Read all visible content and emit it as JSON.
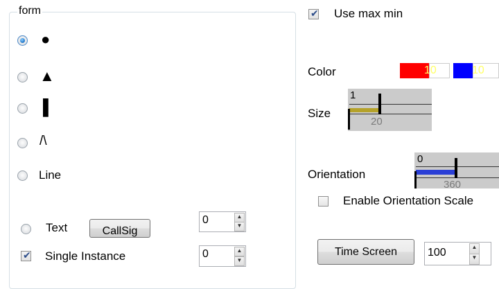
{
  "form_group": {
    "label": "form",
    "shapes": [
      {
        "id": "circle",
        "glyph": "●",
        "checked": true
      },
      {
        "id": "triangle",
        "glyph": "▲",
        "checked": false
      },
      {
        "id": "bar",
        "glyph": "▌",
        "checked": false
      },
      {
        "id": "caret",
        "glyph": "/\\",
        "checked": false
      },
      {
        "id": "line",
        "label": "Line",
        "checked": false
      }
    ],
    "text_radio_label": "Text",
    "callsign_button": "CallSig",
    "text_spinner_value": "0",
    "single_instance": {
      "label": "Single Instance",
      "checked": true,
      "spinner_value": "0"
    }
  },
  "use_max_min": {
    "label": "Use max min",
    "checked": true
  },
  "color": {
    "label": "Color",
    "swatch1": {
      "bg": "#ff0000",
      "text": "10",
      "text_color": "#ffff66"
    },
    "swatch2": {
      "bg": "#0000ff",
      "text": "10",
      "text_color": "#ffff66"
    }
  },
  "size": {
    "label": "Size",
    "value": "1",
    "max": "20",
    "fill_color": "#b5a22a"
  },
  "orientation": {
    "label": "Orientation",
    "value": "0",
    "max": "360",
    "fill_color": "#2b3fd6"
  },
  "enable_orientation_scale": {
    "label": "Enable Orientation Scale",
    "checked": false
  },
  "time_screen": {
    "button": "Time Screen",
    "value": "100"
  }
}
